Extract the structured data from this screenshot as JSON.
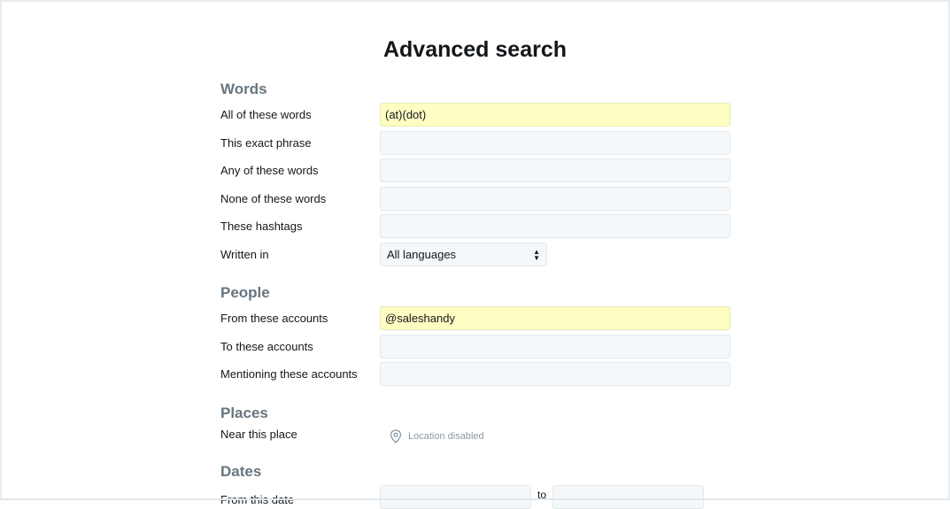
{
  "page": {
    "title": "Advanced search"
  },
  "words": {
    "heading": "Words",
    "all_label": "All of these words",
    "all_value": "(at)(dot)",
    "exact_label": "This exact phrase",
    "exact_value": "",
    "any_label": "Any of these words",
    "any_value": "",
    "none_label": "None of these words",
    "none_value": "",
    "hashtags_label": "These hashtags",
    "hashtags_value": "",
    "written_label": "Written in",
    "language_selected": "All languages"
  },
  "people": {
    "heading": "People",
    "from_label": "From these accounts",
    "from_value": "@saleshandy",
    "to_label": "To these accounts",
    "to_value": "",
    "mentioning_label": "Mentioning these accounts",
    "mentioning_value": ""
  },
  "places": {
    "heading": "Places",
    "near_label": "Near this place",
    "location_status": "Location disabled",
    "location_icon": "map-pin-icon"
  },
  "dates": {
    "heading": "Dates",
    "from_label": "From this date",
    "to_word": "to"
  },
  "colors": {
    "heading": "#66757f",
    "field_bg": "#f5f8fa",
    "filled_bg": "#fefec3",
    "border": "#e1e8ed",
    "muted_text": "#8899a6"
  }
}
